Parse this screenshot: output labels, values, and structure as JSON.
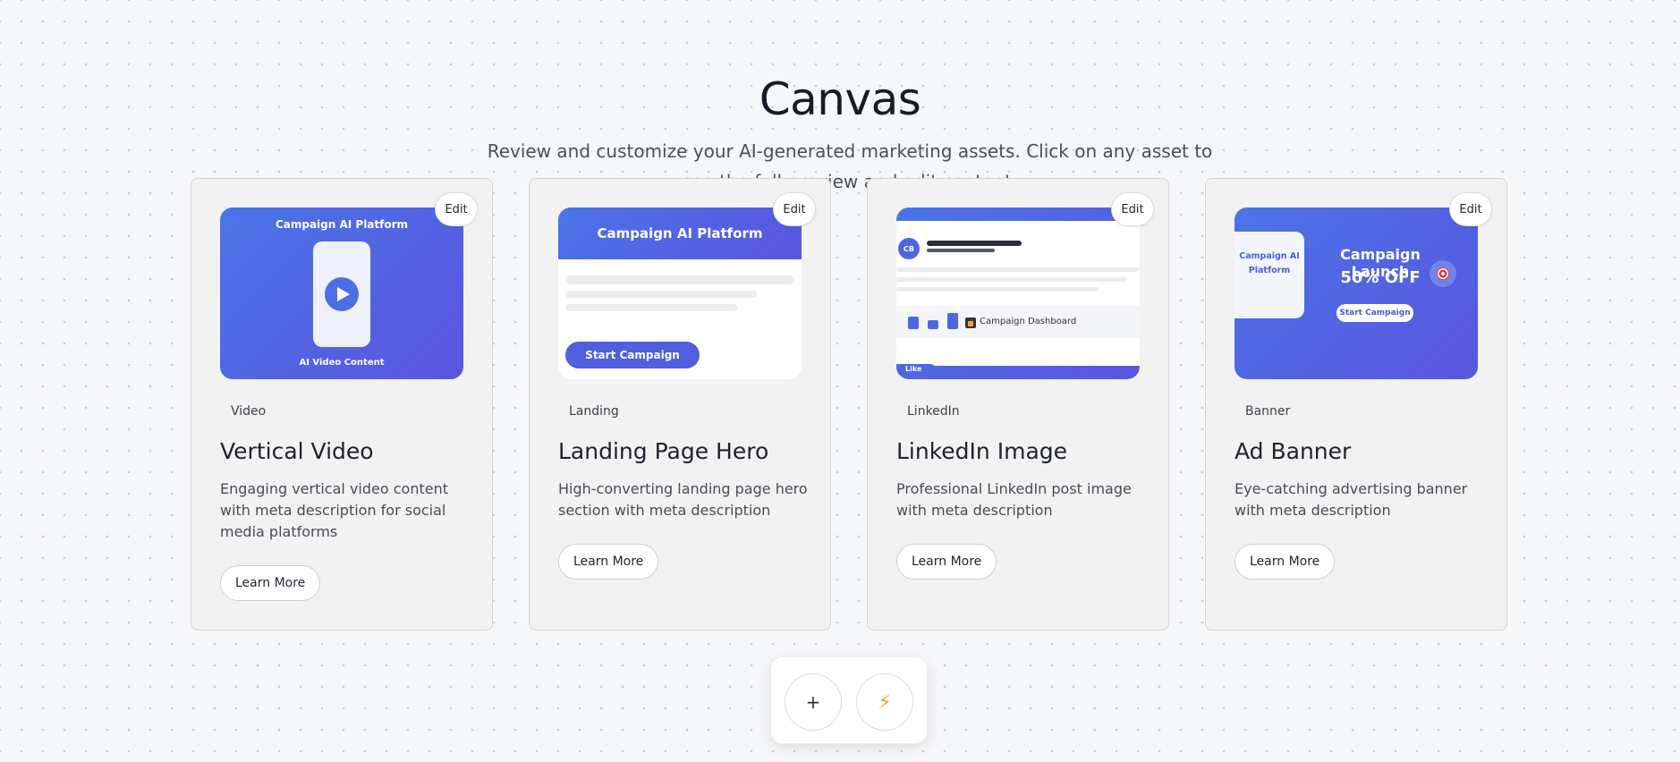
{
  "page": {
    "title": "Canvas",
    "subtitle": "Review and customize your AI-generated marketing assets. Click on any asset to see the full preview and edit content."
  },
  "cards": [
    {
      "edit_label": "Edit",
      "tag": "Video",
      "title": "Vertical Video",
      "description": "Engaging vertical video content with meta description for social media platforms",
      "button": "Learn More",
      "preview": {
        "title": "Campaign AI Platform",
        "subtitle": "AI Video Content"
      }
    },
    {
      "edit_label": "Edit",
      "tag": "Landing",
      "title": "Landing Page Hero",
      "description": "High-converting landing page hero section with meta description",
      "button": "Learn More",
      "preview": {
        "title": "Campaign AI Platform",
        "cta": "Start Campaign"
      }
    },
    {
      "edit_label": "Edit",
      "tag": "LinkedIn",
      "title": "LinkedIn Image",
      "description": "Professional LinkedIn post image with meta description",
      "button": "Learn More",
      "preview": {
        "avatar": "CB",
        "strip_label": "Campaign Dashboard",
        "like": "Like"
      }
    },
    {
      "edit_label": "Edit",
      "tag": "Banner",
      "title": "Ad Banner",
      "description": "Eye-catching advertising banner with meta description",
      "button": "Learn More",
      "preview": {
        "box_text": "Campaign AI Platform",
        "headline": "Campaign Launch",
        "offer": "50% OFF",
        "cta": "Start Campaign"
      }
    }
  ],
  "toolbar": {
    "add_label": "+",
    "bolt_label": "⚡"
  },
  "colors": {
    "accent_gradient_start": "#4a74e6",
    "accent_gradient_end": "#5a55e0",
    "bolt": "#f0a23a"
  }
}
